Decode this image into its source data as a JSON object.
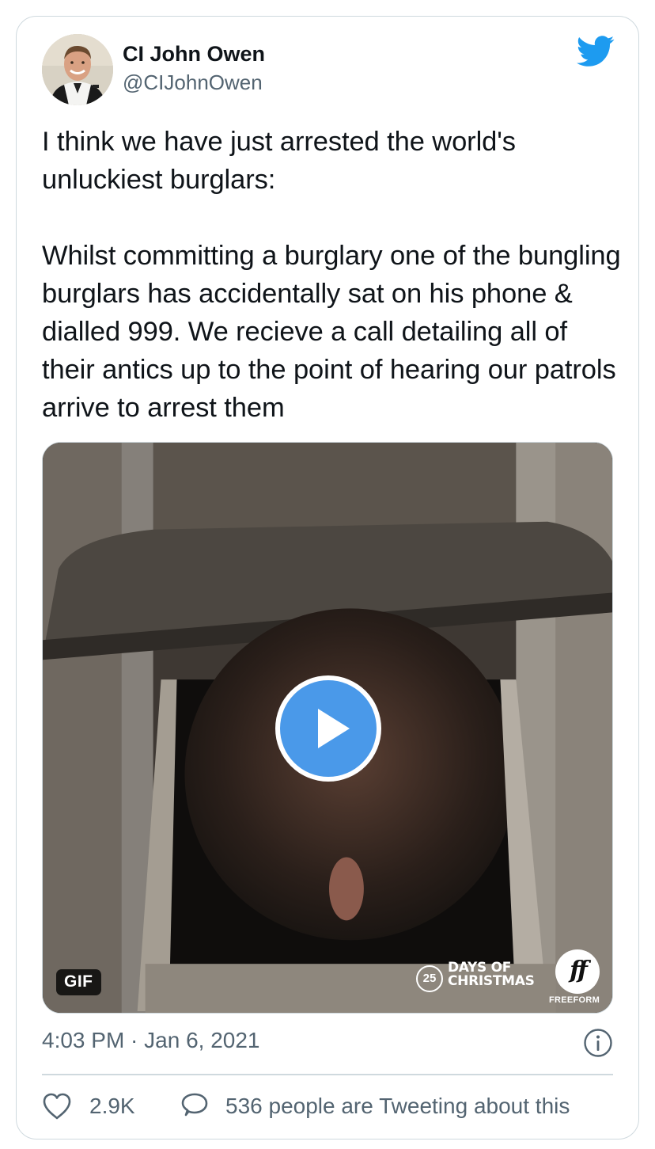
{
  "tweet": {
    "author": {
      "display_name": "CI John Owen",
      "handle": "@CIJohnOwen",
      "avatar_icon": "avatar"
    },
    "platform_icon": "twitter-bird-icon",
    "text": "I think we have just arrested the world's unluckiest burglars:\n\nWhilst committing a burglary one of the bungling burglars has accidentally sat on his phone & dialled 999. We recieve a call detailing all of their antics up to the point of hearing our patrols arrive to arrest them",
    "media": {
      "type": "gif",
      "badge": "GIF",
      "watermark_number": "25",
      "watermark_text": "DAYS OF\nCHRISTMAS",
      "logo_text": "ff",
      "logo_caption": "FREEFORM",
      "play_icon": "play-icon"
    },
    "timestamp": "4:03 PM · Jan 6, 2021",
    "like_count": "2.9K",
    "discussion": "536 people are Tweeting about this"
  },
  "colors": {
    "accent": "#1d9bf0",
    "play_button": "#4a99e9",
    "secondary_text": "#536471",
    "border": "#cfd9de"
  }
}
